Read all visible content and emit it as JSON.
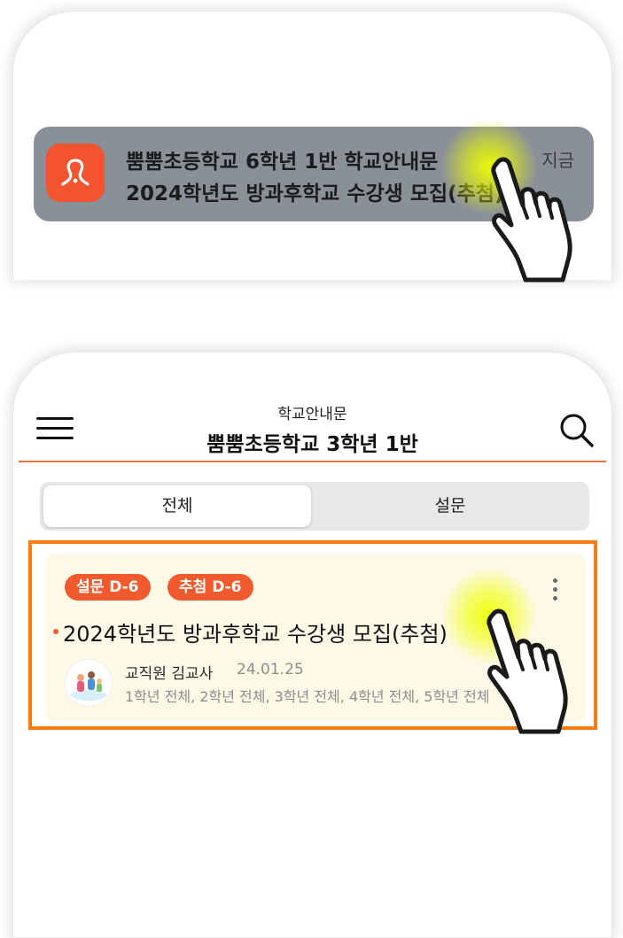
{
  "notification": {
    "title": "뿜뿜초등학교 6학년 1반 학교안내문",
    "body": "2024학년도 방과후학교 수강생 모집(추첨)",
    "time": "지금",
    "icon": "app-logo-icon",
    "icon_color": "#f2542f"
  },
  "header": {
    "subtitle": "학교안내문",
    "title": "뿜뿜초등학교 3학년 1반",
    "menu_icon": "hamburger-menu-icon",
    "search_icon": "search-icon",
    "accent_color": "#f07236"
  },
  "tabs": [
    {
      "label": "전체",
      "active": true
    },
    {
      "label": "설문",
      "active": false
    }
  ],
  "card": {
    "badges": [
      "설문 D-6",
      "추첨 D-6"
    ],
    "title": "2024학년도 방과후학교 수강생 모집(추첨)",
    "author": "교직원 김교사",
    "date": "24.01.25",
    "targets": "1학년 전체, 2학년 전체, 3학년 전체, 4학년 전체, 5학년 전체",
    "highlight_color": "#f57d14",
    "badge_color": "#f05a2c"
  }
}
